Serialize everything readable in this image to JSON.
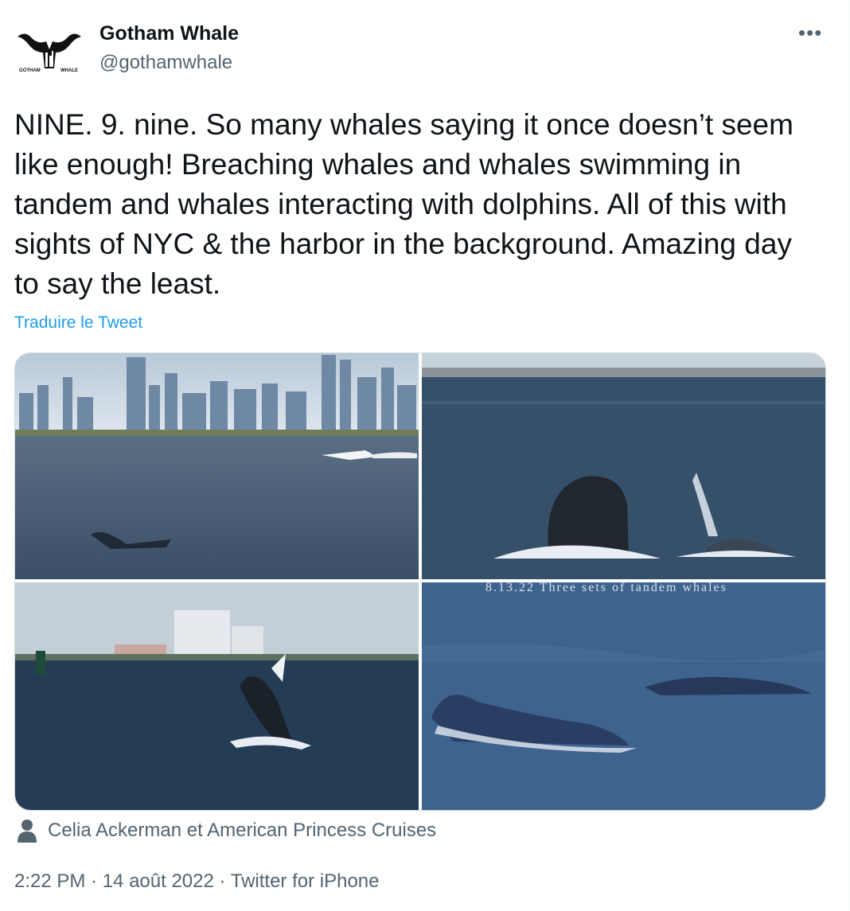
{
  "author": {
    "display_name": "Gotham Whale",
    "handle": "@gothamwhale",
    "avatar_text_left": "GOTHAM",
    "avatar_text_right": "WHALE"
  },
  "more_icon": "more-dots-icon",
  "tweet": {
    "text": "NINE. 9. nine. So many whales saying it once doesn’t seem like enough! Breaching whales and whales swimming in tandem and whales interacting with dolphins. All of this with sights of NYC & the harbor in the background. Amazing day to say the least.",
    "translate_label": "Traduire le Tweet"
  },
  "media": {
    "photos": [
      {
        "name": "whale-tail-skyline-photo"
      },
      {
        "name": "whale-lunge-feeding-photo"
      },
      {
        "name": "whale-breaching-photo"
      },
      {
        "name": "tandem-whales-photo",
        "caption": "8.13.22 Three sets of tandem whales"
      }
    ]
  },
  "tagged": {
    "icon": "person-icon",
    "text": "Celia Ackerman et American Princess Cruises"
  },
  "meta": {
    "text": "2:22 PM · 14 août 2022 · Twitter for iPhone"
  },
  "colors": {
    "link": "#1d9bf0",
    "secondary": "#536471",
    "primary_text": "#0f1419",
    "border": "#cfd9de"
  }
}
